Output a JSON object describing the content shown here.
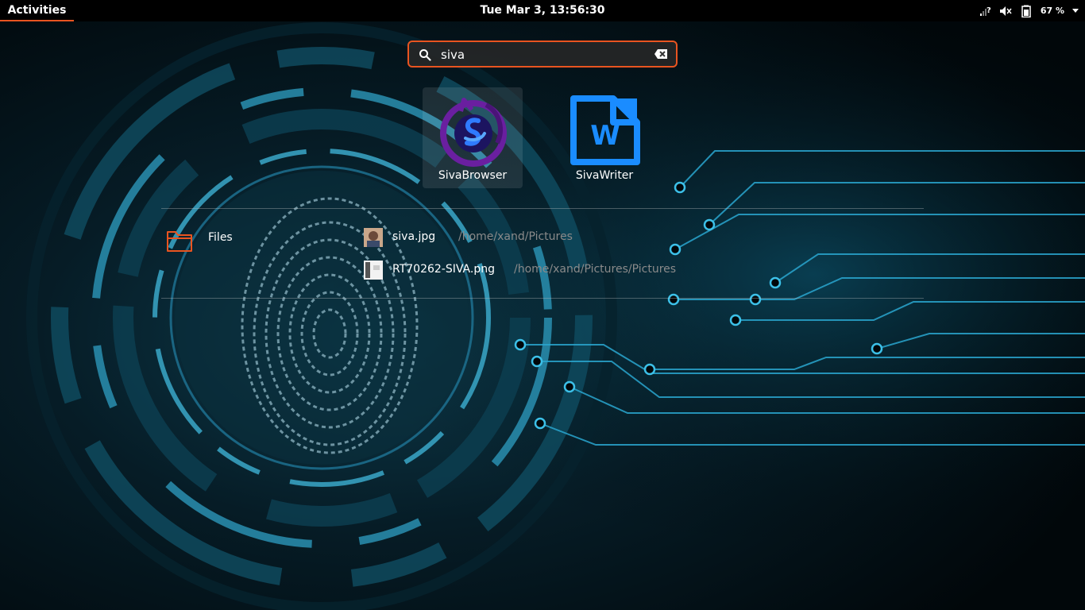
{
  "topbar": {
    "activities_label": "Activities",
    "clock": "Tue Mar  3, 13:56:30",
    "battery_percent": "67 %",
    "icons": [
      "network-unknown-icon",
      "volume-muted-icon",
      "battery-icon",
      "menu-caret-icon"
    ]
  },
  "search": {
    "value": "siva",
    "icon": "search-icon",
    "clear_icon": "clear-text-icon"
  },
  "apps": [
    {
      "label": "SivaBrowser",
      "icon": "browser-app-icon",
      "selected": true
    },
    {
      "label": "SivaWriter",
      "icon": "writer-app-icon",
      "selected": false
    }
  ],
  "providers": [
    {
      "label": "Files",
      "icon": "folder-icon",
      "results": [
        {
          "name": "siva.jpg",
          "path": "/home/xand/Pictures"
        },
        {
          "name": "RT70262-SIVA.png",
          "path": "/home/xand/Pictures/Pictures"
        }
      ]
    }
  ],
  "colors": {
    "accent": "#e95420",
    "browser_purple": "#6a1fa0",
    "writer_blue": "#1a8cff"
  }
}
